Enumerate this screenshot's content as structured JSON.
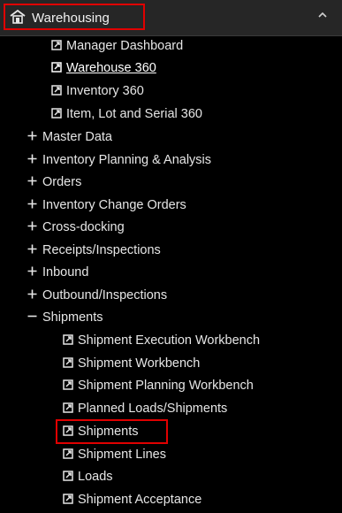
{
  "header": {
    "title": "Warehousing"
  },
  "links_top": [
    "Manager Dashboard",
    "Warehouse 360",
    "Inventory 360",
    "Item, Lot and Serial 360"
  ],
  "groups": [
    "Master Data",
    "Inventory Planning & Analysis",
    "Orders",
    "Inventory Change Orders",
    "Cross-docking",
    "Receipts/Inspections",
    "Inbound",
    "Outbound/Inspections",
    "Shipments"
  ],
  "shipments_links": [
    "Shipment Execution Workbench",
    "Shipment Workbench",
    "Shipment Planning Workbench",
    "Planned Loads/Shipments",
    "Shipments",
    "Shipment Lines",
    "Loads",
    "Shipment Acceptance"
  ],
  "colors": {
    "highlight": "#e00000",
    "background": "#000000",
    "header": "#262626"
  }
}
